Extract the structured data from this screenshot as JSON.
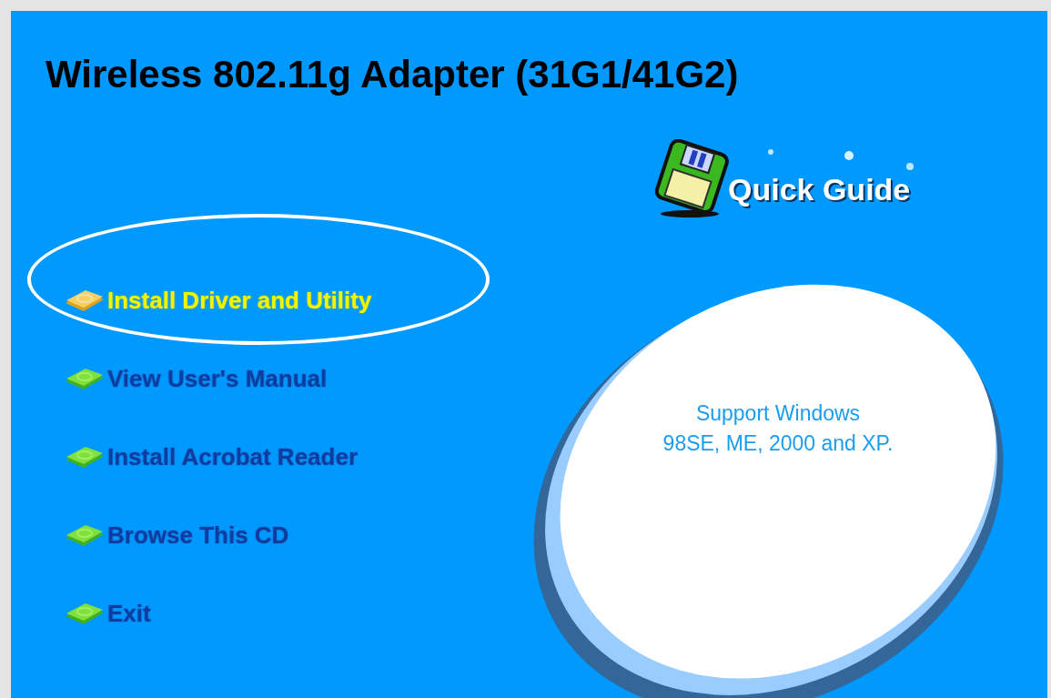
{
  "title": "Wireless 802.11g Adapter (31G1/41G2)",
  "logo": {
    "label": "Quick Guide"
  },
  "menu": [
    {
      "label": "Install Driver and Utility",
      "selected": true
    },
    {
      "label": "View User's Manual",
      "selected": false
    },
    {
      "label": "Install Acrobat Reader",
      "selected": false
    },
    {
      "label": "Browse This CD",
      "selected": false
    },
    {
      "label": "Exit",
      "selected": false
    }
  ],
  "support_note": "Support Windows\n98SE, ME, 2000 and XP."
}
